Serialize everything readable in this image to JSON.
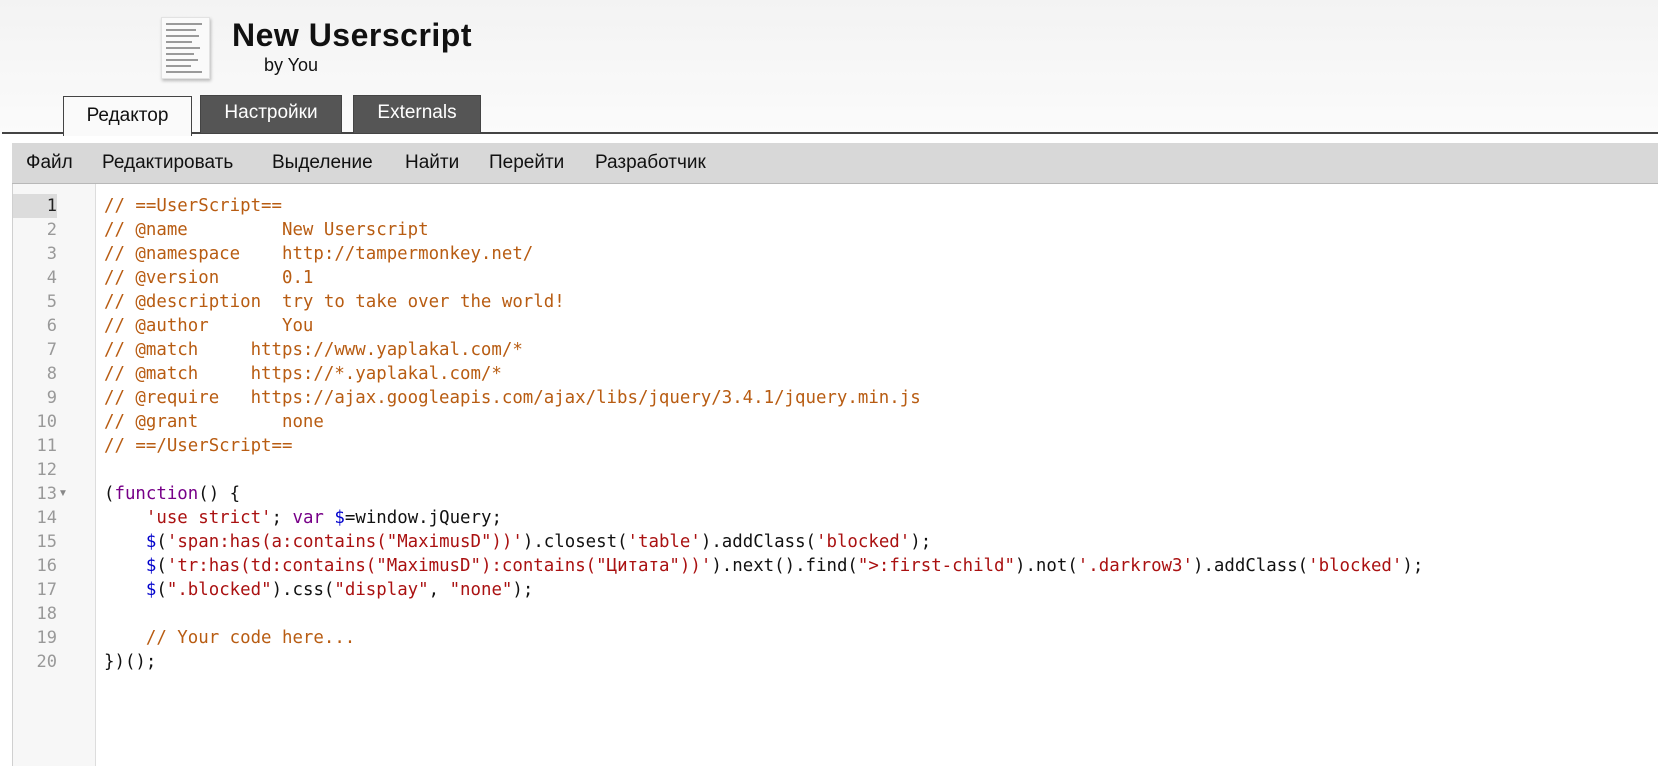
{
  "header": {
    "title": "New Userscript",
    "byline": "by You",
    "icon": "userscript-thumbnail-icon"
  },
  "tabs": [
    {
      "label": "Редактор",
      "active": true
    },
    {
      "label": "Настройки",
      "active": false
    },
    {
      "label": "Externals",
      "active": false
    }
  ],
  "menu": [
    {
      "label": "Файл"
    },
    {
      "label": "Редактировать"
    },
    {
      "label": "Выделение"
    },
    {
      "label": "Найти"
    },
    {
      "label": "Перейти"
    },
    {
      "label": "Разработчик"
    }
  ],
  "editor": {
    "current_line": 1,
    "fold_marker_line": 13,
    "colors": {
      "comment": "#b85c12",
      "keyword": "#770088",
      "string": "#aa1111",
      "variable": "#0000cc"
    },
    "lines": [
      [
        {
          "t": "// ==UserScript==",
          "c": "comment"
        }
      ],
      [
        {
          "t": "// @name         New Userscript",
          "c": "comment"
        }
      ],
      [
        {
          "t": "// @namespace    http://tampermonkey.net/",
          "c": "comment"
        }
      ],
      [
        {
          "t": "// @version      0.1",
          "c": "comment"
        }
      ],
      [
        {
          "t": "// @description  try to take over the world!",
          "c": "comment"
        }
      ],
      [
        {
          "t": "// @author       You",
          "c": "comment"
        }
      ],
      [
        {
          "t": "// @match     https://www.yaplakal.com/*",
          "c": "comment"
        }
      ],
      [
        {
          "t": "// @match     https://*.yaplakal.com/*",
          "c": "comment"
        }
      ],
      [
        {
          "t": "// @require   https://ajax.googleapis.com/ajax/libs/jquery/3.4.1/jquery.min.js",
          "c": "comment"
        }
      ],
      [
        {
          "t": "// @grant        none",
          "c": "comment"
        }
      ],
      [
        {
          "t": "// ==/UserScript==",
          "c": "comment"
        }
      ],
      [],
      [
        {
          "t": "(",
          "c": "plain"
        },
        {
          "t": "function",
          "c": "keyword"
        },
        {
          "t": "() {",
          "c": "plain"
        }
      ],
      [
        {
          "t": "    ",
          "c": "plain"
        },
        {
          "t": "'use strict'",
          "c": "string"
        },
        {
          "t": "; ",
          "c": "plain"
        },
        {
          "t": "var",
          "c": "keyword"
        },
        {
          "t": " ",
          "c": "plain"
        },
        {
          "t": "$",
          "c": "var"
        },
        {
          "t": "=window.jQuery;",
          "c": "plain"
        }
      ],
      [
        {
          "t": "    ",
          "c": "plain"
        },
        {
          "t": "$",
          "c": "var"
        },
        {
          "t": "(",
          "c": "plain"
        },
        {
          "t": "'span:has(a:contains(\"MaximusD\"))'",
          "c": "string"
        },
        {
          "t": ").closest(",
          "c": "plain"
        },
        {
          "t": "'table'",
          "c": "string"
        },
        {
          "t": ").addClass(",
          "c": "plain"
        },
        {
          "t": "'blocked'",
          "c": "string"
        },
        {
          "t": ");",
          "c": "plain"
        }
      ],
      [
        {
          "t": "    ",
          "c": "plain"
        },
        {
          "t": "$",
          "c": "var"
        },
        {
          "t": "(",
          "c": "plain"
        },
        {
          "t": "'tr:has(td:contains(\"MaximusD\"):contains(\"Цитата\"))'",
          "c": "string"
        },
        {
          "t": ").next().find(",
          "c": "plain"
        },
        {
          "t": "\">:first-child\"",
          "c": "string"
        },
        {
          "t": ").not(",
          "c": "plain"
        },
        {
          "t": "'.darkrow3'",
          "c": "string"
        },
        {
          "t": ").addClass(",
          "c": "plain"
        },
        {
          "t": "'blocked'",
          "c": "string"
        },
        {
          "t": ");",
          "c": "plain"
        }
      ],
      [
        {
          "t": "    ",
          "c": "plain"
        },
        {
          "t": "$",
          "c": "var"
        },
        {
          "t": "(",
          "c": "plain"
        },
        {
          "t": "\".blocked\"",
          "c": "string"
        },
        {
          "t": ").css(",
          "c": "plain"
        },
        {
          "t": "\"display\"",
          "c": "string"
        },
        {
          "t": ", ",
          "c": "plain"
        },
        {
          "t": "\"none\"",
          "c": "string"
        },
        {
          "t": ");",
          "c": "plain"
        }
      ],
      [],
      [
        {
          "t": "    // Your code here...",
          "c": "comment"
        }
      ],
      [
        {
          "t": "})();",
          "c": "plain"
        }
      ]
    ]
  }
}
